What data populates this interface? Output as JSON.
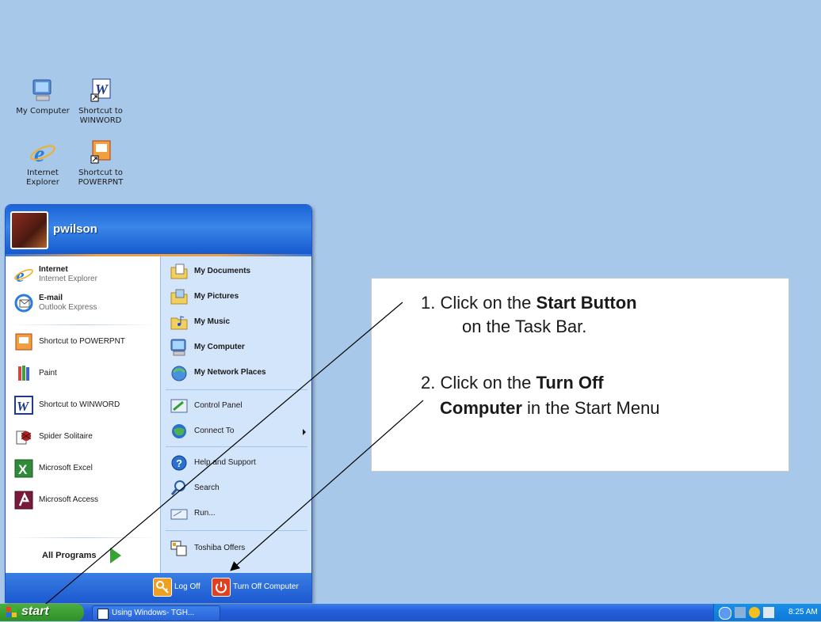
{
  "desktop_icons": [
    {
      "name": "My Computer",
      "icon": "my-computer-icon"
    },
    {
      "name": "Shortcut to\nWINWORD",
      "icon": "word-icon"
    },
    {
      "name": "Internet\nExplorer",
      "icon": "ie-icon"
    },
    {
      "name": "Shortcut to\nPOWERPNT",
      "icon": "powerpoint-icon"
    }
  ],
  "start_menu": {
    "user": "pwilson",
    "pinned": [
      {
        "title": "Internet",
        "subtitle": "Internet Explorer"
      },
      {
        "title": "E-mail",
        "subtitle": "Outlook Express"
      }
    ],
    "recent": [
      "Shortcut to POWERPNT",
      "Paint",
      "Shortcut to WINWORD",
      "Spider Solitaire",
      "Microsoft Excel",
      "Microsoft Access"
    ],
    "all_programs": "All Programs",
    "places": [
      "My Documents",
      "My Pictures",
      "My Music",
      "My Computer",
      "My Network Places"
    ],
    "settings": [
      "Control Panel",
      "Connect To"
    ],
    "help": [
      "Help and Support",
      "Search",
      "Run..."
    ],
    "extra": [
      "Toshiba Offers"
    ],
    "log_off": "Log Off",
    "turn_off": "Turn Off Computer"
  },
  "taskbar": {
    "start_label": "start",
    "task": "Using Windows- TGH...",
    "clock": "8:25 AM"
  },
  "callout": {
    "step1_prefix": "1.  Click on the ",
    "step1_bold": "Start Button",
    "step1_suffix": "on the Task Bar.",
    "step2_prefix": "2. Click on the ",
    "step2_bold": "Turn Off",
    "step2_bold2": "Computer",
    "step2_suffix": " in the Start Menu"
  }
}
